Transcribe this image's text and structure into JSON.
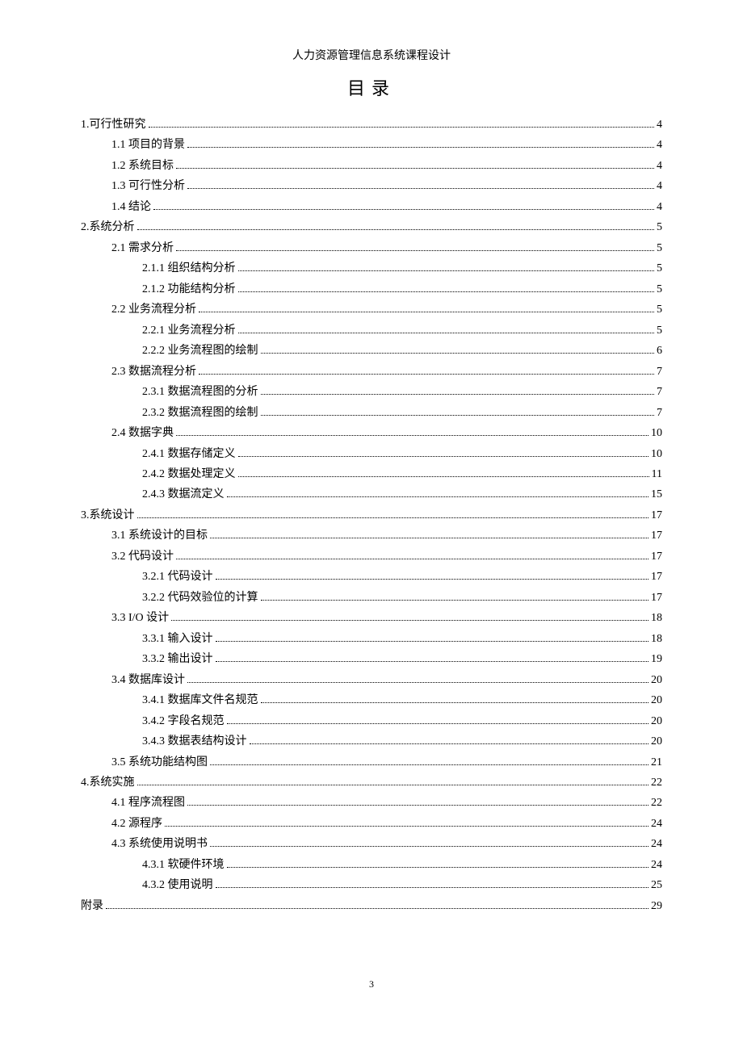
{
  "header_title": "人力资源管理信息系统课程设计",
  "toc_title": "目录",
  "footer_page": "3",
  "entries": [
    {
      "indent": 0,
      "label": "1.可行性研究",
      "page": "4"
    },
    {
      "indent": 1,
      "label": "1.1 项目的背景",
      "page": "4"
    },
    {
      "indent": 1,
      "label": "1.2 系统目标",
      "page": "4"
    },
    {
      "indent": 1,
      "label": "1.3 可行性分析",
      "page": "4"
    },
    {
      "indent": 1,
      "label": "1.4 结论",
      "page": "4"
    },
    {
      "indent": 0,
      "label": "2.系统分析",
      "page": "5"
    },
    {
      "indent": 1,
      "label": "2.1 需求分析",
      "page": "5"
    },
    {
      "indent": 2,
      "label": "2.1.1 组织结构分析",
      "page": "5"
    },
    {
      "indent": 2,
      "label": "2.1.2 功能结构分析",
      "page": "5"
    },
    {
      "indent": 1,
      "label": "2.2 业务流程分析",
      "page": "5"
    },
    {
      "indent": 2,
      "label": "2.2.1 业务流程分析",
      "page": "5"
    },
    {
      "indent": 2,
      "label": "2.2.2 业务流程图的绘制",
      "page": "6"
    },
    {
      "indent": 1,
      "label": "2.3  数据流程分析",
      "page": "7"
    },
    {
      "indent": 2,
      "label": "2.3.1 数据流程图的分析",
      "page": "7"
    },
    {
      "indent": 2,
      "label": "2.3.2 数据流程图的绘制",
      "page": "7"
    },
    {
      "indent": 1,
      "label": "2.4 数据字典",
      "page": "10"
    },
    {
      "indent": 2,
      "label": "2.4.1 数据存储定义",
      "page": "10"
    },
    {
      "indent": 2,
      "label": "2.4.2 数据处理定义",
      "page": "11"
    },
    {
      "indent": 2,
      "label": "2.4.3 数据流定义",
      "page": "15"
    },
    {
      "indent": 0,
      "label": "3.系统设计",
      "page": "17"
    },
    {
      "indent": 1,
      "label": "3.1 系统设计的目标",
      "page": "17"
    },
    {
      "indent": 1,
      "label": "3.2 代码设计",
      "page": "17"
    },
    {
      "indent": 2,
      "label": "3.2.1 代码设计",
      "page": "17"
    },
    {
      "indent": 2,
      "label": "3.2.2 代码效验位的计算",
      "page": "17"
    },
    {
      "indent": 1,
      "label": "3.3 I/O 设计",
      "page": "18"
    },
    {
      "indent": 2,
      "label": "3.3.1 输入设计",
      "page": "18"
    },
    {
      "indent": 2,
      "label": "3.3.2 输出设计",
      "page": "19"
    },
    {
      "indent": 1,
      "label": "3.4 数据库设计",
      "page": "20"
    },
    {
      "indent": 2,
      "label": "3.4.1 数据库文件名规范",
      "page": "20"
    },
    {
      "indent": 2,
      "label": "3.4.2 字段名规范",
      "page": "20"
    },
    {
      "indent": 2,
      "label": "3.4.3 数据表结构设计",
      "page": "20"
    },
    {
      "indent": 1,
      "label": "3.5 系统功能结构图",
      "page": "21"
    },
    {
      "indent": 0,
      "label": "4.系统实施",
      "page": "22"
    },
    {
      "indent": 1,
      "label": "4.1 程序流程图",
      "page": "22"
    },
    {
      "indent": 1,
      "label": "4.2 源程序",
      "page": "24"
    },
    {
      "indent": 1,
      "label": "4.3 系统使用说明书",
      "page": "24"
    },
    {
      "indent": 2,
      "label": "4.3.1 软硬件环境",
      "page": "24"
    },
    {
      "indent": 2,
      "label": "4.3.2 使用说明",
      "page": "25"
    },
    {
      "indent": 0,
      "label": "附录",
      "page": "29"
    }
  ]
}
